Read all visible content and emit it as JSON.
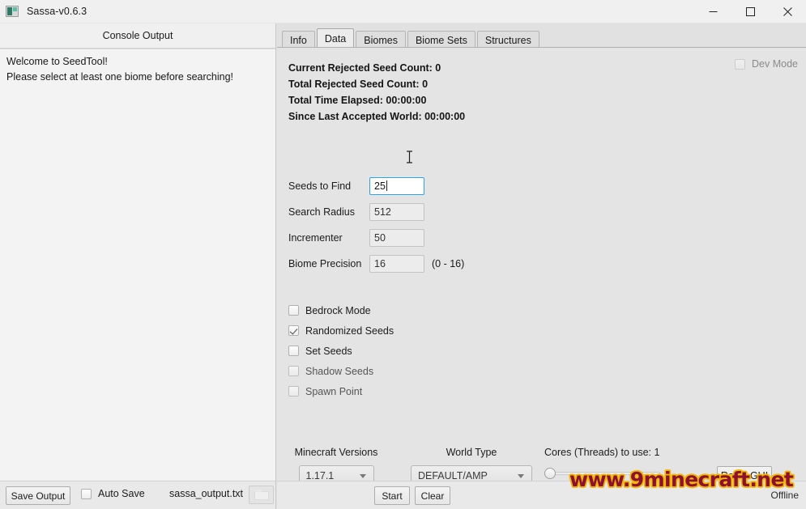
{
  "window": {
    "title": "Sassa-v0.6.3",
    "icon": "app-icon",
    "controls": {
      "minimize": "minimize-icon",
      "maximize": "maximize-icon",
      "close": "close-icon"
    }
  },
  "console": {
    "header": "Console Output",
    "lines": [
      "Welcome to SeedTool!",
      "Please select at least one biome before searching!"
    ]
  },
  "save_bar": {
    "save_output_label": "Save Output",
    "auto_save_label": "Auto Save",
    "auto_save_checked": false,
    "file_name": "sassa_output.txt",
    "browse_icon": "folder-icon"
  },
  "tabs": [
    {
      "label": "Info",
      "selected": false
    },
    {
      "label": "Data",
      "selected": true
    },
    {
      "label": "Biomes",
      "selected": false
    },
    {
      "label": "Biome Sets",
      "selected": false
    },
    {
      "label": "Structures",
      "selected": false
    }
  ],
  "dev_mode": {
    "label": "Dev Mode",
    "checked": false,
    "disabled": true
  },
  "status": {
    "lines": [
      "Current Rejected Seed Count: 0",
      "Total Rejected Seed Count: 0",
      "Total Time Elapsed:  00:00:00",
      "Since Last Accepted World:  00:00:00"
    ]
  },
  "form": {
    "rows": [
      {
        "label": "Seeds to Find",
        "value": "25",
        "hint": "",
        "focused": true
      },
      {
        "label": "Search Radius",
        "value": "512",
        "hint": "",
        "focused": false
      },
      {
        "label": "Incrementer",
        "value": "50",
        "hint": "",
        "focused": false
      },
      {
        "label": "Biome Precision",
        "value": "16",
        "hint": "(0 - 16)",
        "focused": false
      }
    ]
  },
  "options": [
    {
      "label": "Bedrock Mode",
      "checked": false,
      "dim": false
    },
    {
      "label": "Randomized Seeds",
      "checked": true,
      "dim": false
    },
    {
      "label": "Set Seeds",
      "checked": false,
      "dim": false
    },
    {
      "label": "Shadow Seeds",
      "checked": false,
      "dim": true
    },
    {
      "label": "Spawn Point",
      "checked": false,
      "dim": true
    }
  ],
  "versions": {
    "caption": "Minecraft Versions",
    "selected": "1.17.1"
  },
  "world_type": {
    "caption": "World Type",
    "selected": "DEFAULT/AMP"
  },
  "cores": {
    "caption": "Cores (Threads) to use:  1",
    "value": 1
  },
  "reset_gui_label": "Reset GUI",
  "actions": {
    "start_label": "Start",
    "clear_label": "Clear",
    "status_label": "Offline"
  },
  "watermark": "www.9minecraft.net",
  "colors": {
    "window_bg": "#e1e1e1",
    "panel_bg": "#f0f0f0",
    "focus_border": "#3c9bd9",
    "watermark_fill": "#8c1033",
    "watermark_outline": "#f2b705"
  }
}
